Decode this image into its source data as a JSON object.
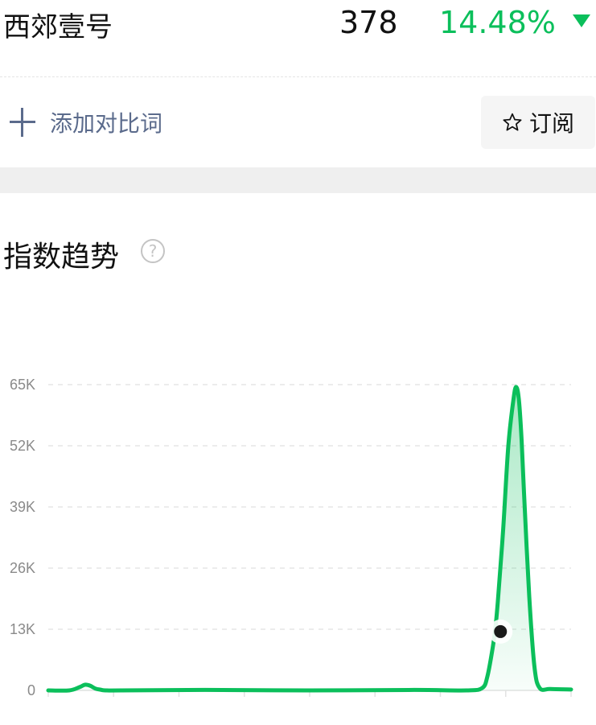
{
  "header": {
    "keyword": "西郊壹号",
    "index_value": "378",
    "change_pct": "14.48%",
    "trend_direction": "down",
    "trend_color": "#0bbf5b"
  },
  "actions": {
    "add_compare_label": "添加对比词",
    "subscribe_label": "订阅"
  },
  "section": {
    "title": "指数趋势",
    "help_symbol": "?"
  },
  "chart_data": {
    "type": "area",
    "color": "#0bbf5b",
    "ylim": [
      0,
      65000
    ],
    "yticks": [
      {
        "value": 65000,
        "label": "65K"
      },
      {
        "value": 52000,
        "label": "52K"
      },
      {
        "value": 39000,
        "label": "39K"
      },
      {
        "value": 26000,
        "label": "26K"
      },
      {
        "value": 13000,
        "label": "13K"
      },
      {
        "value": 0,
        "label": "0"
      }
    ],
    "grid": true,
    "x_ticks": 8,
    "series": [
      {
        "x": [
          0,
          0.04,
          0.06,
          0.07,
          0.08,
          0.09,
          0.1,
          0.11,
          0.14,
          0.3,
          0.5,
          0.7,
          0.8,
          0.83,
          0.84,
          0.85,
          0.855,
          0.86,
          0.87,
          0.88,
          0.89,
          0.895,
          0.9,
          0.905,
          0.91,
          0.92,
          0.93,
          0.94,
          0.96,
          1
        ],
        "values": [
          0,
          0,
          700,
          1200,
          1000,
          400,
          150,
          0,
          0,
          100,
          0,
          100,
          0,
          500,
          3000,
          9000,
          13000,
          19000,
          34000,
          52000,
          62000,
          64500,
          62000,
          54000,
          42000,
          20000,
          5000,
          500,
          300,
          200
        ]
      }
    ],
    "marker": {
      "x": 0.865,
      "value": 12500
    }
  }
}
